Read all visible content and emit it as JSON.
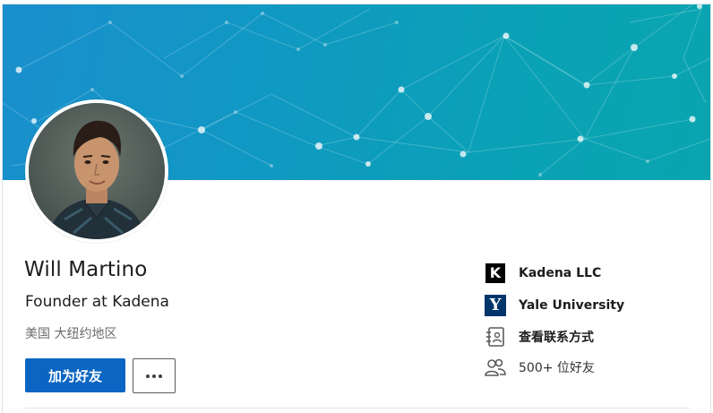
{
  "profile": {
    "name": "Will Martino",
    "headline": "Founder at Kadena",
    "location": "美国 大纽约地区"
  },
  "actions": {
    "connect_label": "加为好友",
    "more_icon": "more-horizontal-icon"
  },
  "sidebar": {
    "company": {
      "label": "Kadena LLC",
      "logo_text": "K",
      "icon": "kadena-logo"
    },
    "school": {
      "label": "Yale University",
      "logo_text": "Y",
      "icon": "yale-logo"
    },
    "contact": {
      "label": "查看联系方式",
      "icon": "contact-card-icon"
    },
    "connections": {
      "label": "500+ 位好友",
      "icon": "people-icon"
    }
  },
  "colors": {
    "primary": "#0a66c2",
    "banner_start": "#1a8fcd",
    "banner_end": "#0aa5b0",
    "yale_blue": "#00356b"
  }
}
